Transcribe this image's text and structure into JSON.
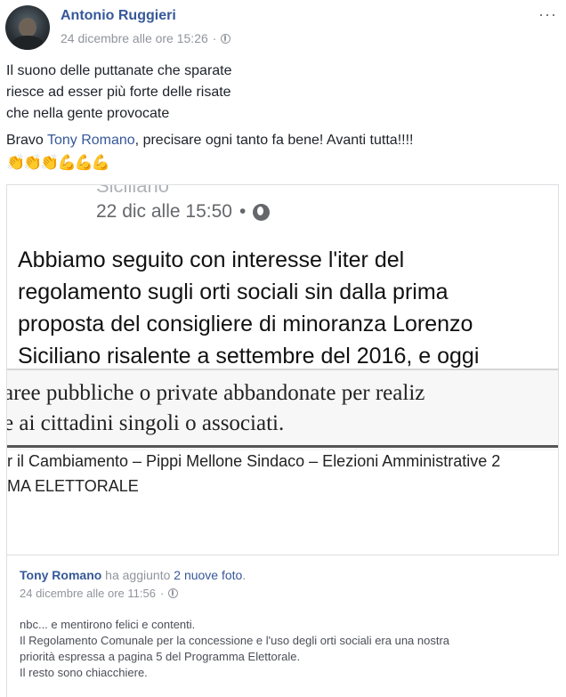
{
  "post": {
    "author": "Antonio Ruggieri",
    "time": "24 dicembre alle ore 15:26",
    "dot": "·",
    "more": "···",
    "lines": [
      "Il suono delle puttanate che sparate",
      "riesce ad esser più forte delle risate",
      "che nella gente provocate"
    ],
    "bravo_prefix": "Bravo ",
    "mention": "Tony Romano",
    "bravo_suffix": ", precisare ogni tanto fa bene! Avanti tutta!!!!",
    "emojis": "👏👏👏💪💪💪"
  },
  "photo": {
    "cut_text": "Siciliano",
    "time": "22 dic alle 15:50",
    "dot": "•",
    "text_lines": [
      "Abbiamo seguito con interesse l'iter del",
      "regolamento sugli orti sociali sin dalla prima",
      "proposta del consigliere di minoranza Lorenzo",
      "Siciliano risalente a settembre del 2016, e oggi"
    ],
    "scan_line1": "aree pubbliche o private abbandonate per realiz",
    "scan_line2": "e ai cittadini singoli o associati.",
    "scan_line3": "r il Cambiamento – Pippi Mellone Sindaco – Elezioni Amministrative 2",
    "scan_line4": "MA ELETTORALE"
  },
  "shared": {
    "name": "Tony Romano",
    "action": " ha aggiunto ",
    "photos_link": "2 nuove foto",
    "period": ".",
    "time": "24 dicembre alle ore 11:56",
    "dot": "·",
    "desc": [
      "nbc... e mentirono felici e contenti.",
      "Il Regolamento Comunale per la concessione e l'uso degli orti sociali era una nostra",
      "priorità espressa a pagina 5 del Programma Elettorale.",
      "Il resto sono chiacchiere."
    ]
  }
}
